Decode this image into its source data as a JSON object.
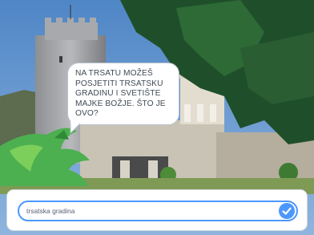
{
  "speech_bubble": {
    "text": "NA TRSATU MOŽEŠ POSJETITI TRSATSKU GRADINU I SVETIŠTE MAJKE BOŽJE. ŠTO JE OVO?"
  },
  "answer_box": {
    "value": "trsatska gradina",
    "submit_icon": "check-icon"
  },
  "colors": {
    "accent": "#4c97ff",
    "bubble_text": "#404a55",
    "sprite": "#4caf50"
  }
}
